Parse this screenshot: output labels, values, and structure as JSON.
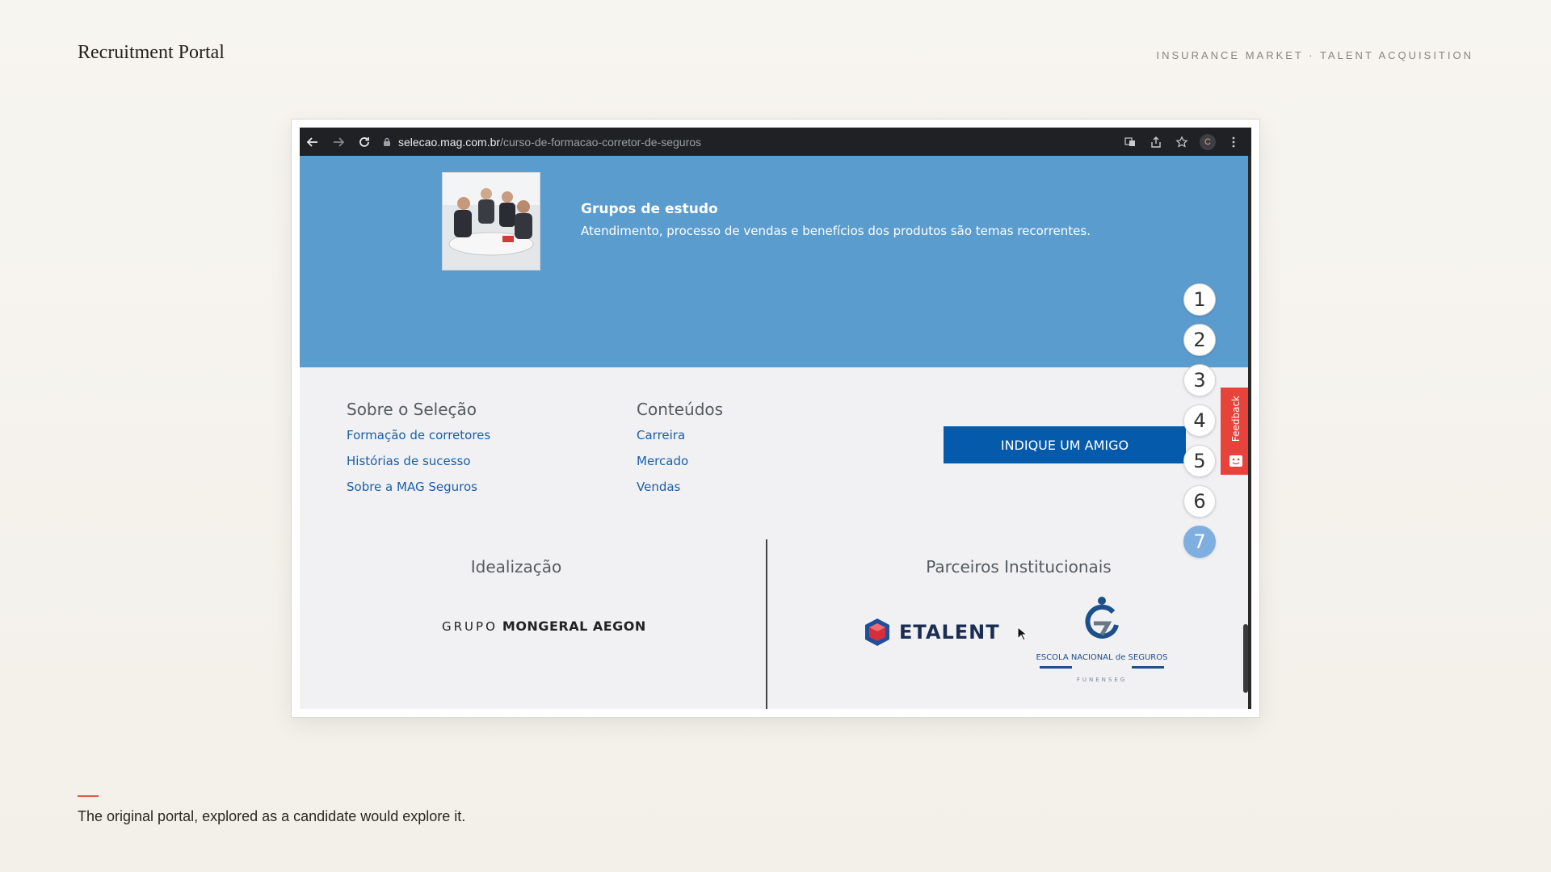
{
  "page": {
    "title": "Recruitment Portal",
    "tagline": "INSURANCE MARKET · TALENT ACQUISITION",
    "caption": "The original portal, explored as a candidate would explore it."
  },
  "browser": {
    "url_host": "selecao.mag.com.br",
    "url_path": "/curso-de-formacao-corretor-de-seguros",
    "profile_initial": "C"
  },
  "hero": {
    "title": "Grupos de estudo",
    "description": "Atendimento, processo de vendas e benefícios dos produtos são temas recorrentes."
  },
  "footer": {
    "col1": {
      "heading": "Sobre o Seleção",
      "links": [
        "Formação de corretores",
        "Histórias de sucesso",
        "Sobre a MAG Seguros"
      ]
    },
    "col2": {
      "heading": "Conteúdos",
      "links": [
        "Carreira",
        "Mercado",
        "Vendas"
      ]
    },
    "cta_label": "INDIQUE UM AMIGO"
  },
  "sections": {
    "idealizacao": "Idealização",
    "parceiros": "Parceiros Institucionais"
  },
  "logos": {
    "mongeral_grupo": "GRUPO",
    "mongeral_brand": "MONGERAL AEGON",
    "etalent": "ETALENT",
    "ens_name": "ESCOLA NACIONAL de SEGUROS",
    "ens_sub": "FUNENSEG"
  },
  "steps": {
    "labels": [
      "1",
      "2",
      "3",
      "4",
      "5",
      "6",
      "7"
    ],
    "active_index": 6
  },
  "feedback_label": "Feedback",
  "colors": {
    "hero_blue": "#5b9ccf",
    "link_blue": "#1a5fa8",
    "cta_blue": "#065aab",
    "feedback_red": "#e8433b",
    "step_active": "#7faee0",
    "accent": "#d4613e"
  }
}
